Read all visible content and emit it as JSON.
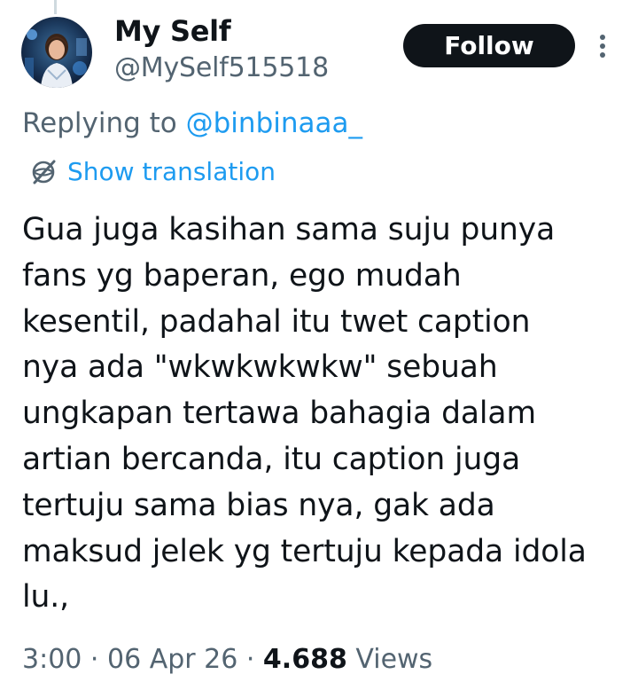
{
  "author": {
    "display_name": "My Self",
    "handle": "@MySelf515518",
    "avatar_icon": "profile-photo"
  },
  "actions": {
    "follow_label": "Follow",
    "more_icon": "more-vertical-icon"
  },
  "reply": {
    "prefix": "Replying to ",
    "mention": "@binbinaaa_"
  },
  "translation": {
    "icon": "translate-globe-icon",
    "label": "Show translation"
  },
  "tweet": {
    "text": "Gua juga kasihan sama suju punya\nfans yg baperan, ego mudah\nkesentil, padahal itu twet caption\nnya ada  \"wkwkwkwkw\" sebuah\nungkapan tertawa bahagia dalam\nartian bercanda, itu caption juga\ntertuju sama bias nya, gak ada\nmaksud jelek yg tertuju kepada idola\nlu.,"
  },
  "meta": {
    "time": "3:00",
    "sep1": " · ",
    "date": "06 Apr 26",
    "sep2": " · ",
    "views_count": "4.688",
    "views_label": " Views"
  },
  "colors": {
    "text": "#0f1419",
    "secondary": "#536471",
    "link": "#1d9bf0",
    "button_bg": "#0f1419",
    "button_text": "#ffffff"
  }
}
